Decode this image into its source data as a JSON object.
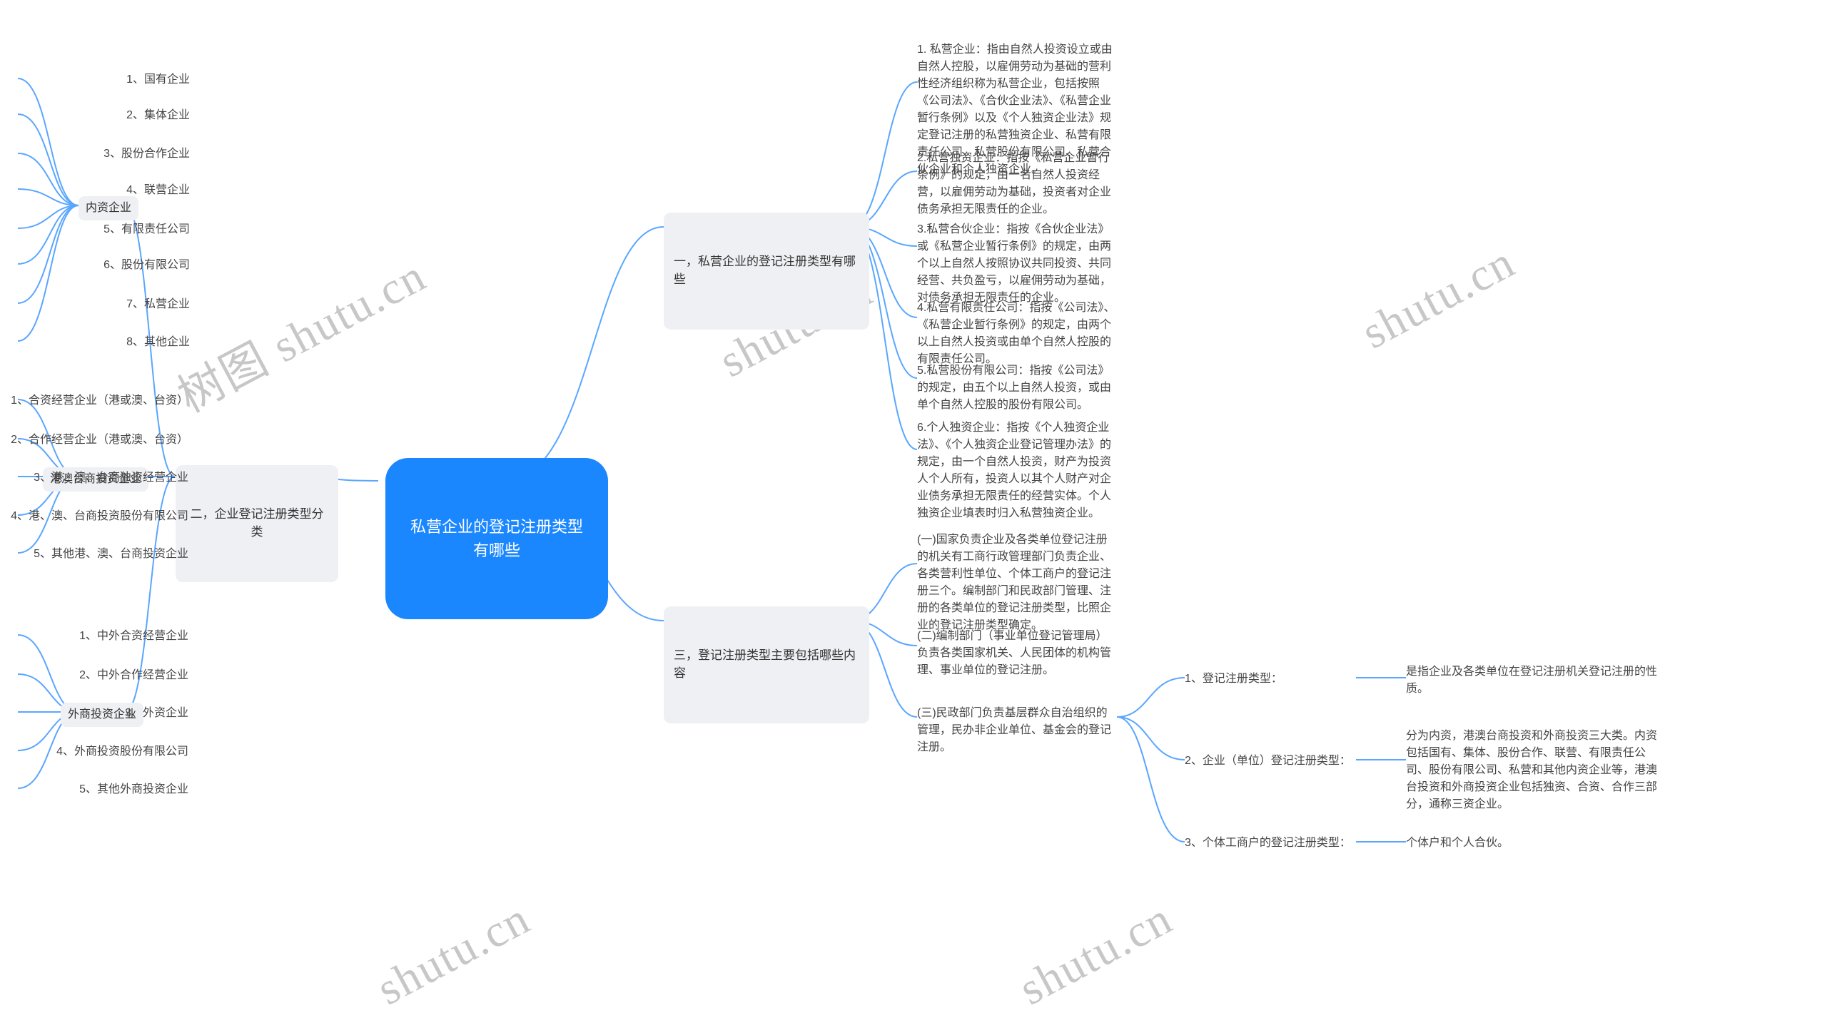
{
  "root": {
    "title": "私营企业的登记注册类型\n有哪些"
  },
  "branch1": {
    "title": "一，私营企业的登记注册类型有哪\n些",
    "items": [
      "1. 私营企业：指由自然人投资设立或由自然人控股，以雇佣劳动为基础的营利性经济组织称为私营企业，包括按照《公司法》、《合伙企业法》、《私营企业暂行条例》以及《个人独资企业法》规定登记注册的私营独资企业、私营有限责任公司、私营股份有限公司、私营合伙企业和个人独资企业。",
      "2.私营独资企业：指按《私营企业暂行条例》的规定，由一名自然人投资经营，以雇佣劳动为基础，投资者对企业债务承担无限责任的企业。",
      "3.私营合伙企业：指按《合伙企业法》或《私营企业暂行条例》的规定，由两个以上自然人按照协议共同投资、共同经营、共负盈亏，以雇佣劳动为基础，对债务承担无限责任的企业。",
      "4.私营有限责任公司：指按《公司法》、《私营企业暂行条例》的规定，由两个以上自然人投资或由单个自然人控股的有限责任公司。",
      "5.私营股份有限公司：指按《公司法》的规定，由五个以上自然人投资，或由单个自然人控股的股份有限公司。",
      "6.个人独资企业：指按《个人独资企业法》、《个人独资企业登记管理办法》的规定，由一个自然人投资，财产为投资人个人所有，投资人以其个人财产对企业债务承担无限责任的经营实体。个人独资企业填表时归入私营独资企业。"
    ]
  },
  "branch2": {
    "title": "二，企业登记注册类型分类",
    "subs": {
      "a": {
        "label": "内资企业",
        "items": [
          "1、国有企业",
          "2、集体企业",
          "3、股份合作企业",
          "4、联营企业",
          "5、有限责任公司",
          "6、股份有限公司",
          "7、私营企业",
          "8、其他企业"
        ]
      },
      "b": {
        "label": "港澳台商投资企业",
        "items": [
          "1、合资经营企业（港或澳、台资）",
          "2、合作经营企业（港或澳、台资）",
          "3、港、澳、台商独资经营企业",
          "4、港、澳、台商投资股份有限公司",
          "5、其他港、澳、台商投资企业"
        ]
      },
      "c": {
        "label": "外商投资企业",
        "items": [
          "1、中外合资经营企业",
          "2、中外合作经营企业",
          "3、外资企业",
          "4、外商投资股份有限公司",
          "5、其他外商投资企业"
        ]
      }
    }
  },
  "branch3": {
    "title": "三，登记注册类型主要包括哪些内\n容",
    "items": [
      "(一)国家负责企业及各类单位登记注册的机关有工商行政管理部门负责企业、各类营利性单位、个体工商户的登记注册三个。编制部门和民政部门管理、注册的各类单位的登记注册类型，比照企业的登记注册类型确定。",
      "(二)编制部门（事业单位登记管理局）负责各类国家机关、人民团体的机构管理、事业单位的登记注册。",
      "(三)民政部门负责基层群众自治组织的管理，民办非企业单位、基金会的登记注册。"
    ],
    "sub3": {
      "items": [
        {
          "label": "1、登记注册类型：",
          "desc": "是指企业及各类单位在登记注册机关登记注册的性质。"
        },
        {
          "label": "2、企业（单位）登记注册类型：",
          "desc": "分为内资，港澳台商投资和外商投资三大类。内资包括国有、集体、股份合作、联营、有限责任公司、股份有限公司、私营和其他内资企业等，港澳台投资和外商投资企业包括独资、合资、合作三部分，通称三资企业。"
        },
        {
          "label": "3、个体工商户的登记注册类型：",
          "desc": "个体户和个人合伙。"
        }
      ]
    }
  },
  "watermarks": [
    "树图 shutu.cn",
    "shutu.cn",
    "shutu.cn",
    "shutu.cn",
    "shutu.cn"
  ]
}
